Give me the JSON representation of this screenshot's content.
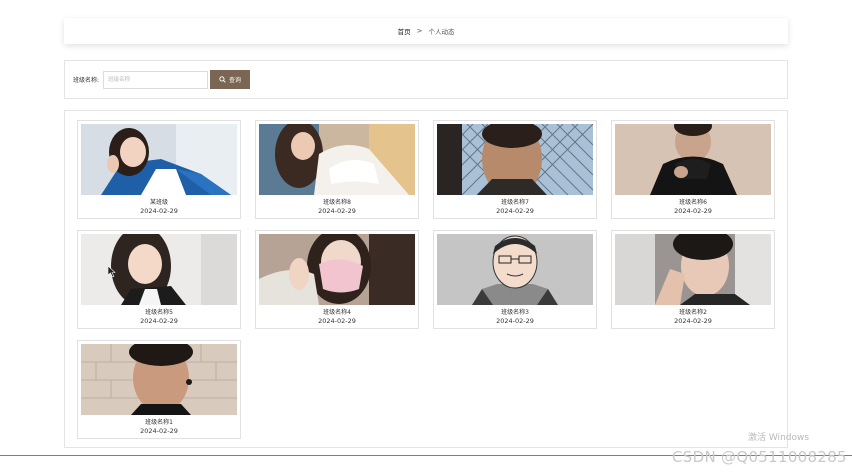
{
  "breadcrumb": {
    "home": "首页",
    "separator": ">",
    "current": "个人动态"
  },
  "search": {
    "label": "班级名称:",
    "placeholder": "班级名称",
    "value": "",
    "button_label": "查询",
    "button_color": "#7a6652"
  },
  "cards": [
    {
      "name": "某班级",
      "date": "2024-02-29",
      "photo": "girl-blue-jacket"
    },
    {
      "name": "班级名称8",
      "date": "2024-02-29",
      "photo": "girl-white-sweater"
    },
    {
      "name": "班级名称7",
      "date": "2024-02-29",
      "photo": "man-chain-fence"
    },
    {
      "name": "班级名称6",
      "date": "2024-02-29",
      "photo": "man-black-turtleneck"
    },
    {
      "name": "班级名称5",
      "date": "2024-02-29",
      "photo": "girl-long-hair"
    },
    {
      "name": "班级名称4",
      "date": "2024-02-29",
      "photo": "girl-face-mask"
    },
    {
      "name": "班级名称3",
      "date": "2024-02-29",
      "photo": "cartoon-man-glasses"
    },
    {
      "name": "班级名称2",
      "date": "2024-02-29",
      "photo": "man-profile"
    },
    {
      "name": "班级名称1",
      "date": "2024-02-29",
      "photo": "man-earring"
    }
  ],
  "watermarks": {
    "windows": "激活 Windows",
    "csdn": "CSDN @Q0511008285"
  }
}
